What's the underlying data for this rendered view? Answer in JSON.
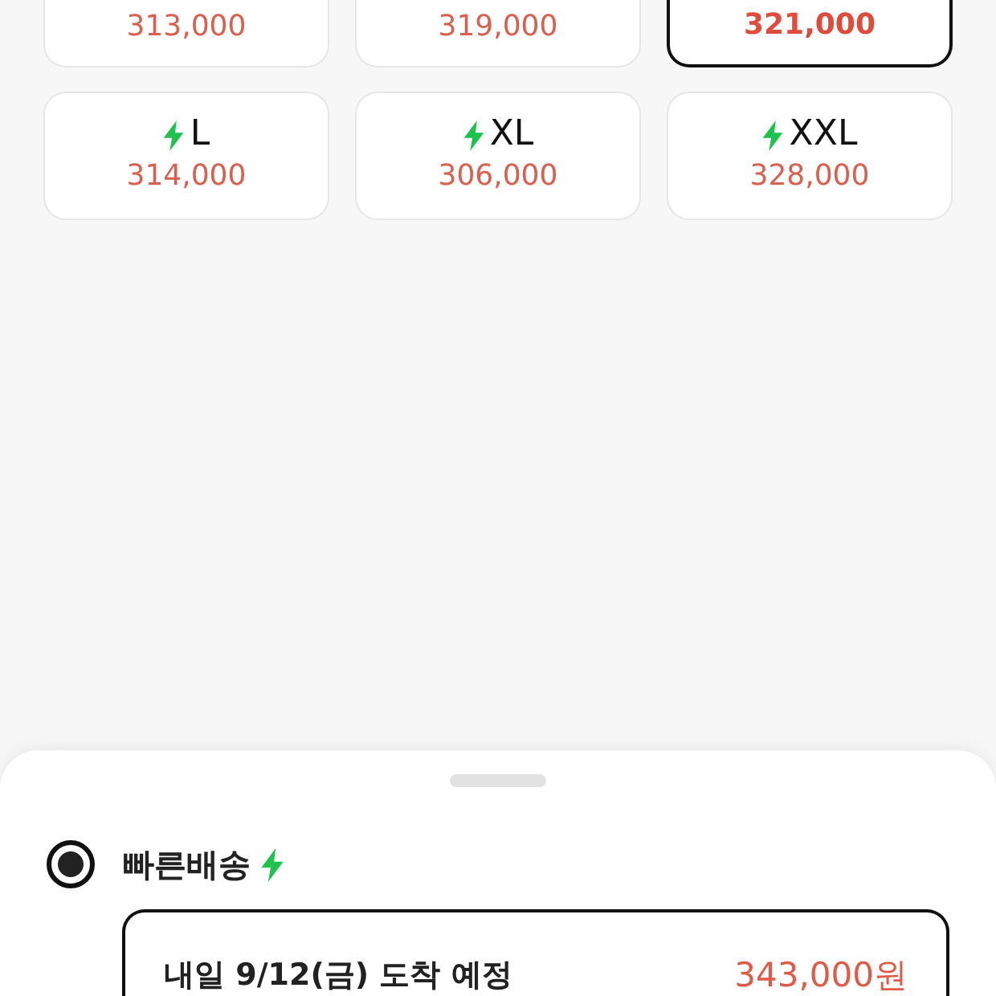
{
  "size_options": [
    {
      "kind": "partial",
      "price": "313,000",
      "selected": false
    },
    {
      "kind": "partial",
      "price": "319,000",
      "selected": false
    },
    {
      "kind": "partial",
      "price": "321,000",
      "selected": true
    },
    {
      "kind": "full",
      "label": "L",
      "fast": true,
      "price": "314,000",
      "selected": false
    },
    {
      "kind": "full",
      "label": "XL",
      "fast": true,
      "price": "306,000",
      "selected": false
    },
    {
      "kind": "full",
      "label": "XXL",
      "fast": true,
      "price": "328,000",
      "selected": false
    }
  ],
  "delivery_sheet": {
    "options": [
      {
        "label": "빠른배송",
        "fast": true,
        "selected": true,
        "detail": {
          "text": "내일 9/12(금) 도착 예정",
          "price": "343,000원"
        }
      }
    ]
  }
}
